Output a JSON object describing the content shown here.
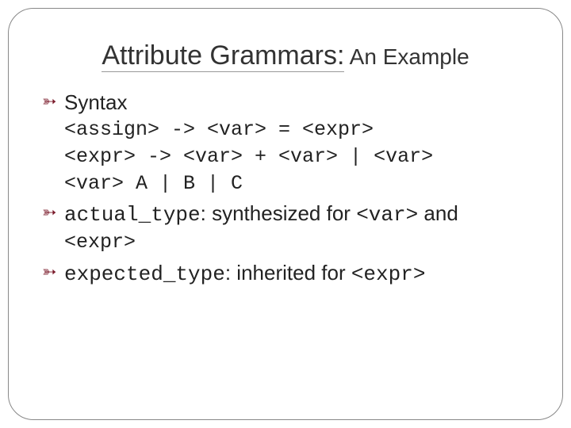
{
  "title": {
    "main": "Attribute Grammars:",
    "sub": " An Example"
  },
  "bullets": {
    "b1_label": "Syntax",
    "grammar": {
      "l1": "<assign> -> <var> = <expr>",
      "l2": "<expr> -> <var> + <var> | <var>",
      "l3": "<var> A | B | C"
    },
    "b2_code": "actual_type",
    "b2_colon": ": ",
    "b2_txt1": "synthesized for ",
    "b2_code2": "<var>",
    "b2_txt2": " and ",
    "b2_cont_code": "<expr>",
    "b3_code": "expected_type",
    "b3_colon": ": ",
    "b3_txt1": "inherited for ",
    "b3_code2": "<expr>"
  }
}
